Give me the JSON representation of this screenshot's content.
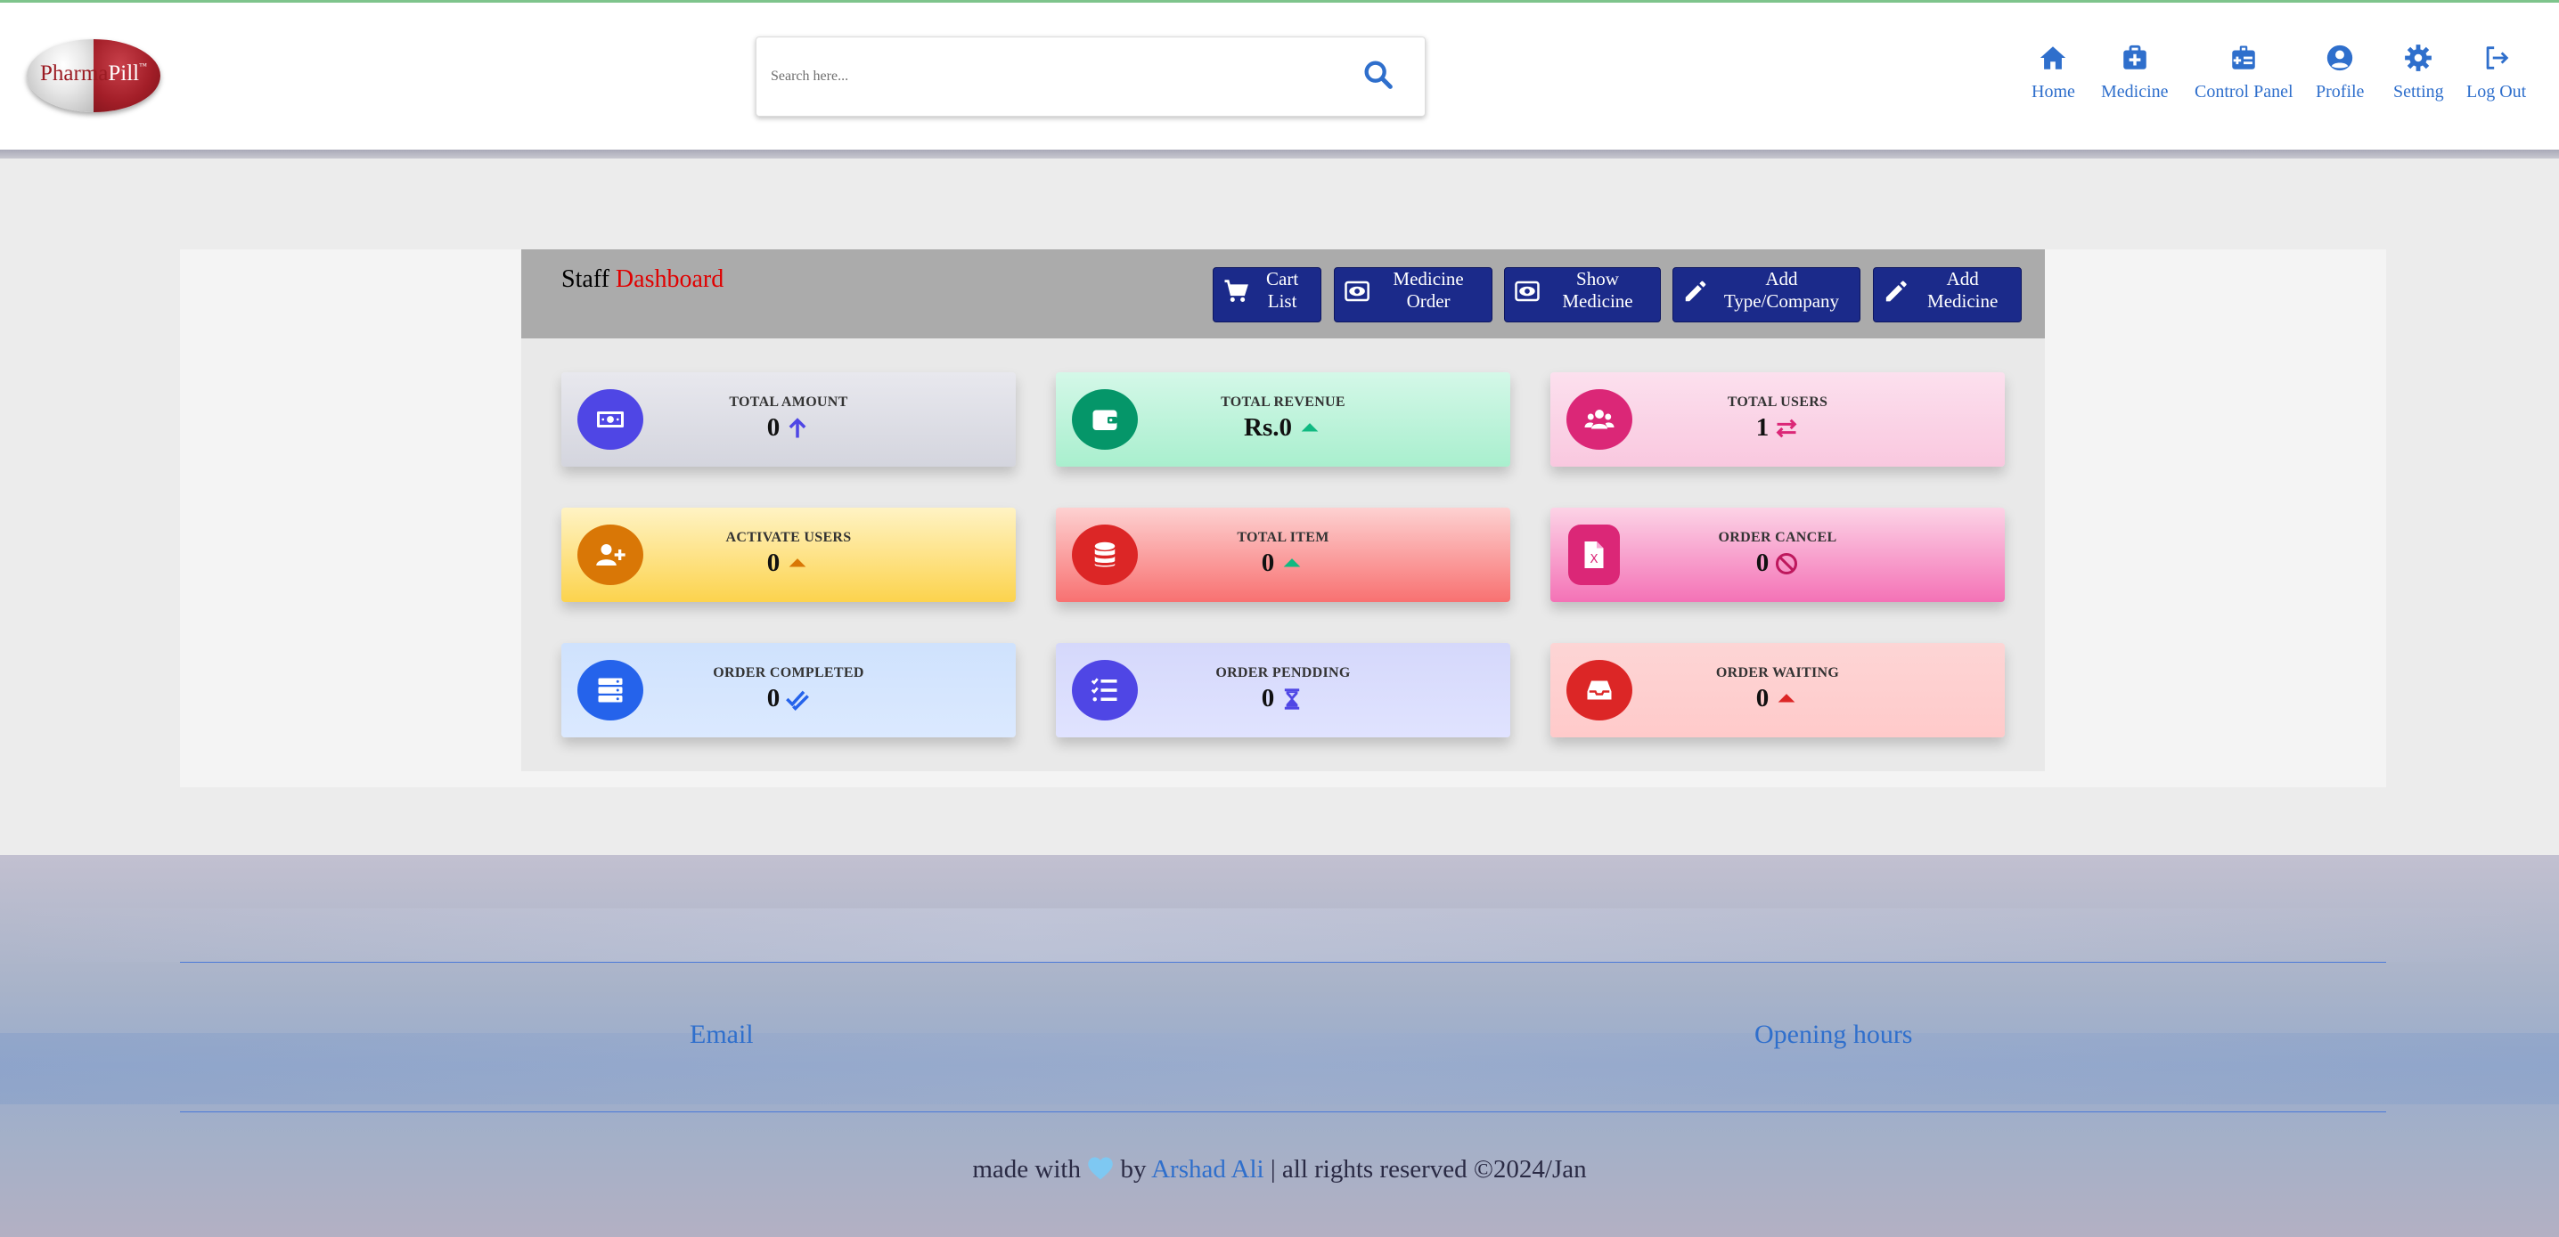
{
  "logo": {
    "part1": "Pharma",
    "part2": "Pill",
    "tm": "™"
  },
  "search": {
    "placeholder": "Search here...",
    "value": ""
  },
  "nav": [
    {
      "label": "Home",
      "icon": "home-icon"
    },
    {
      "label": "Medicine",
      "icon": "medical-kit-icon"
    },
    {
      "label": "Control Panel",
      "icon": "id-badge-icon"
    },
    {
      "label": "Profile",
      "icon": "user-circle-icon"
    },
    {
      "label": "Setting",
      "icon": "gear-icon"
    },
    {
      "label": "Log Out",
      "icon": "logout-icon"
    }
  ],
  "dashboard": {
    "title_prefix": "Staff",
    "title_highlight": "Dashboard",
    "buttons": [
      {
        "label": "Cart List",
        "icon": "cart-icon"
      },
      {
        "label": "Medicine Order",
        "icon": "eye-icon"
      },
      {
        "label": "Show Medicine",
        "icon": "eye-icon"
      },
      {
        "label": "Add Type/Company",
        "icon": "pencil-icon"
      },
      {
        "label": "Add Medicine",
        "icon": "pencil-icon"
      }
    ],
    "cards": [
      {
        "label": "Total Amount",
        "value": "0",
        "icon": "money-icon",
        "indicator": "arrow-up-icon",
        "accent": "#4f46e5"
      },
      {
        "label": "Total Revenue",
        "value": "Rs.0",
        "icon": "wallet-icon",
        "indicator": "caret-up-icon",
        "accent": "#059669"
      },
      {
        "label": "Total Users",
        "value": "1",
        "icon": "users-icon",
        "indicator": "exchange-icon",
        "accent": "#db2777"
      },
      {
        "label": "Activate Users",
        "value": "0",
        "icon": "user-plus-icon",
        "indicator": "caret-up-icon",
        "accent": "#d97706"
      },
      {
        "label": "Total Item",
        "value": "0",
        "icon": "database-icon",
        "indicator": "caret-up-icon",
        "accent": "#dc2626"
      },
      {
        "label": "Order Cancel",
        "value": "0",
        "icon": "file-excel-icon",
        "indicator": "ban-icon",
        "accent": "#db2777"
      },
      {
        "label": "Order Completed",
        "value": "0",
        "icon": "server-icon",
        "indicator": "double-check-icon",
        "accent": "#2563eb"
      },
      {
        "label": "Order Pendding",
        "value": "0",
        "icon": "list-check-icon",
        "indicator": "hourglass-icon",
        "accent": "#4f46e5"
      },
      {
        "label": "Order Waiting",
        "value": "0",
        "icon": "inbox-icon",
        "indicator": "caret-up-icon",
        "accent": "#dc2626"
      }
    ]
  },
  "footer": {
    "email_label": "Email",
    "hours_label": "Opening hours",
    "credit_prefix": "made with",
    "credit_by": "by",
    "author": "Arshad Ali",
    "credit_suffix": "| all rights reserved ©2024/Jan"
  },
  "colors": {
    "nav_accent": "#2f6fcc",
    "button_bg": "#1b2a8a",
    "title_highlight": "#e00000"
  }
}
